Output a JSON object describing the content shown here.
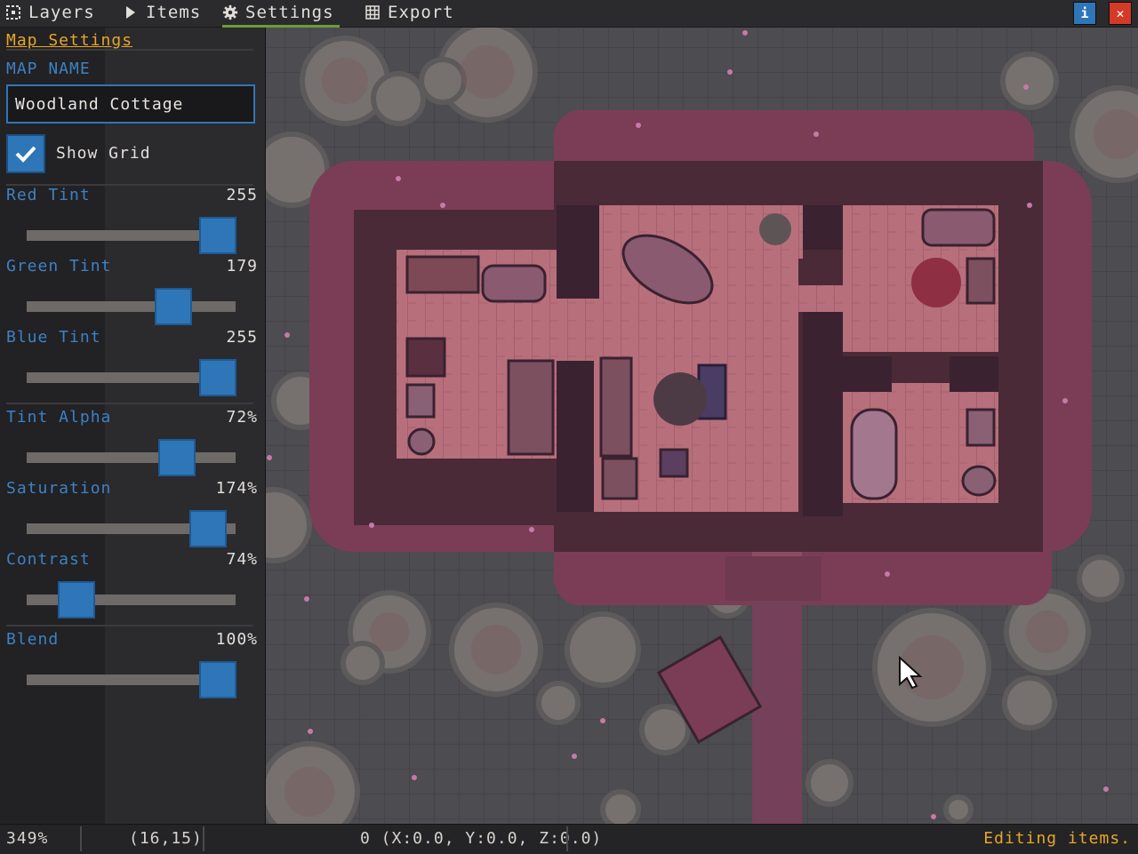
{
  "toolbar": {
    "tabs": [
      {
        "label": "Layers",
        "icon": "layers-icon"
      },
      {
        "label": "Items",
        "icon": "cursor-arrow-icon"
      },
      {
        "label": "Settings",
        "icon": "gear-icon",
        "active": true
      },
      {
        "label": "Export",
        "icon": "grid-export-icon"
      }
    ],
    "info_label": "i",
    "close_label": "✕"
  },
  "panel": {
    "title": "Map Settings",
    "map_name_label": "MAP NAME",
    "map_name_value": "Woodland Cottage",
    "show_grid_label": "Show Grid",
    "show_grid_checked": true,
    "sliders": [
      {
        "label": "Red Tint",
        "value": "255",
        "fraction": 1.0
      },
      {
        "label": "Green Tint",
        "value": "179",
        "fraction": 0.7
      },
      {
        "label": "Blue Tint",
        "value": "255",
        "fraction": 1.0
      },
      {
        "label": "Tint Alpha",
        "value": "72%",
        "fraction": 0.72
      },
      {
        "label": "Saturation",
        "value": "174%",
        "fraction": 0.87
      },
      {
        "label": "Contrast",
        "value": "74%",
        "fraction": 0.24
      },
      {
        "label": "Blend",
        "value": "100%",
        "fraction": 1.0
      }
    ]
  },
  "status": {
    "zoom": "349%",
    "tile_coords": "(16,15)",
    "selection": "0 (X:0.0, Y:0.0, Z:0.0)",
    "mode": "Editing items."
  },
  "colors": {
    "accent_blue": "#2f76b8",
    "section_orange": "#e6a62a",
    "close_red": "#d43a26",
    "active_tab_green": "#6a9c3a"
  }
}
